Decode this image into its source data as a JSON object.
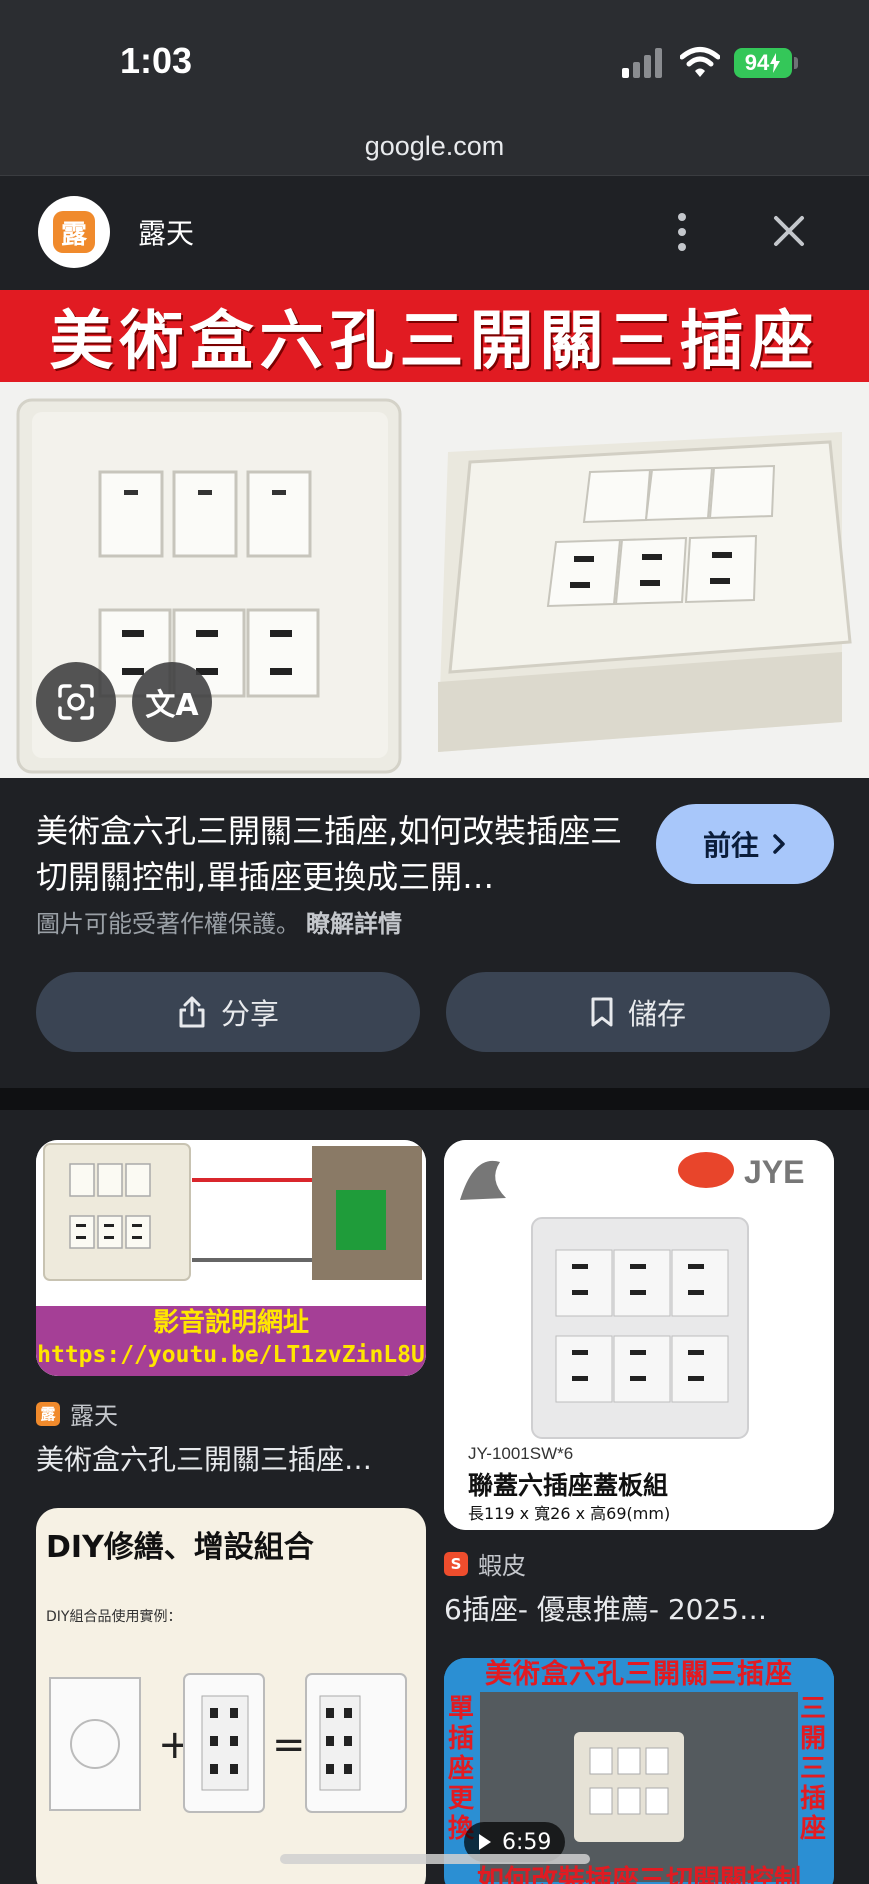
{
  "status_bar": {
    "time": "1:03",
    "battery": "94"
  },
  "browser": {
    "url": "google.com"
  },
  "viewer": {
    "site_name": "露天",
    "site_logo_char": "露",
    "hero_banner_text": "美術盒六孔三開關三插座",
    "translate_glyph": "文A",
    "title": "美術盒六孔三開關三插座,如何改裝插座三切開關控制,單插座更換成三開…",
    "goto_label": "前往",
    "copyright_notice": "圖片可能受著作權保護。",
    "learn_more": "瞭解詳情",
    "share_label": "分享",
    "save_label": "儲存"
  },
  "related": [
    {
      "source": "露天",
      "source_icon_char": "露",
      "title": "美術盒六孔三開關三插座…",
      "image_caption_1": "影音説明網址",
      "image_caption_2": "https://youtu.be/LT1zvZinL8U"
    },
    {
      "source": "蝦皮",
      "source_icon_char": "S",
      "title": "6插座- 優惠推薦- 2025…",
      "image_brand": "JYE",
      "image_model": "JY-1001SW*6",
      "image_product": "聯蓋六插座蓋板組",
      "image_dims": "長119 x 寬26 x 高69(mm)"
    },
    {
      "image_heading": "DIY修繕、增設組合",
      "image_sub": "DIY組合品使用實例："
    },
    {
      "image_banner": "美術盒六孔三開關三插座",
      "image_left_text": "單插座更換",
      "image_right_text": "三開三插座",
      "image_bottom_text": "如何改裝插座三切開關控制",
      "duration": "6:59"
    }
  ]
}
